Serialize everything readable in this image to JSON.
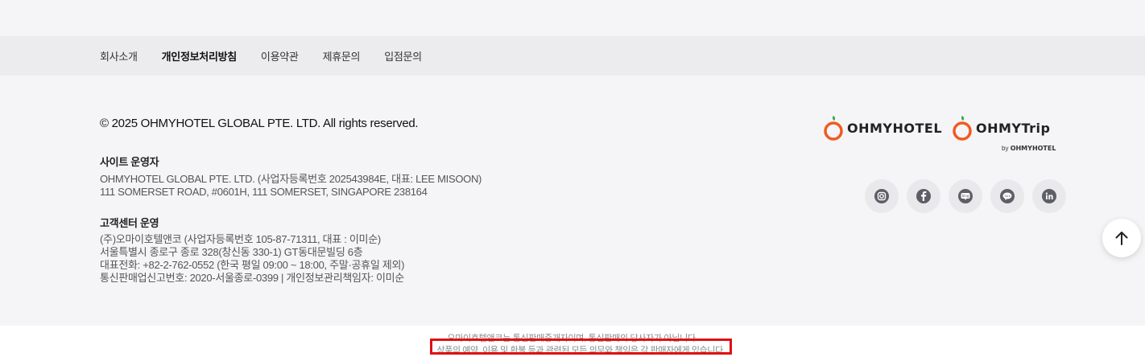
{
  "nav": {
    "items": [
      {
        "label": "회사소개",
        "bold": false
      },
      {
        "label": "개인정보처리방침",
        "bold": true
      },
      {
        "label": "이용약관",
        "bold": false
      },
      {
        "label": "제휴문의",
        "bold": false
      },
      {
        "label": "입점문의",
        "bold": false
      }
    ]
  },
  "footer": {
    "copyright": "© 2025 OHMYHOTEL GLOBAL PTE. LTD. All rights reserved.",
    "operator": {
      "title": "사이트 운영자",
      "lines": [
        "OHMYHOTEL GLOBAL PTE. LTD. (사업자등록번호 202543984E, 대표: LEE MISOON)",
        "111 SOMERSET ROAD, #0601H, 111 SOMERSET, SINGAPORE 238164"
      ]
    },
    "customer_center": {
      "title": "고객센터 운영",
      "lines": [
        "(주)오마이호텔앤코 (사업자등록번호 105-87-71311, 대표 : 이미순)",
        "서울특별시 종로구 종로 328(창신동 330-1) GT동대문빌딩 6층",
        "대표전화: +82-2-762-0552 (한국 평일 09:00 ~ 18:00, 주말·공휴일 제외)",
        "통신판매업신고번호: 2020-서울종로-0399 | 개인정보관리책임자: 이미순"
      ]
    },
    "logos": {
      "hotel_word": "OHMYHOTEL",
      "trip_word": "OHMYTrip",
      "trip_sub_by": "by",
      "trip_sub_brand": "OHMYHOTEL",
      "accent_color": "#f05a22",
      "leaf_color": "#3aa84a"
    },
    "social": [
      {
        "icon": "instagram-icon",
        "label": "IG"
      },
      {
        "icon": "facebook-icon",
        "label": "f"
      },
      {
        "icon": "blog-icon",
        "label": "blog"
      },
      {
        "icon": "talk-icon",
        "label": "TALK"
      },
      {
        "icon": "linkedin-icon",
        "label": "in"
      }
    ]
  },
  "notices": {
    "line1": "오마이호텔앤코는 통신판매중개자이며, 통신판매의 당사자가 아닙니다.",
    "line2": "상품의 예약, 이용 및 환불 등과 관련된 모든 의무와 책임은 각 판매자에게 있습니다."
  },
  "scroll_top": {
    "icon": "arrow-up-icon"
  }
}
